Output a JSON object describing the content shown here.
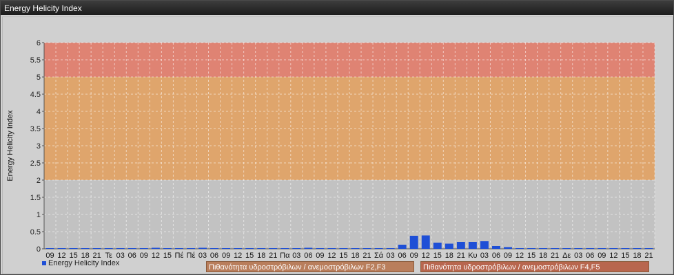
{
  "window": {
    "title": "Energy Helicity Index"
  },
  "colors": {
    "band_low": "#c0c0c0",
    "band_mid": "#e0a060",
    "band_high": "#e07a68",
    "bar": "#1e4fd6"
  },
  "legend": {
    "series_label": "Energy Helicity Index",
    "bands": [
      {
        "label": "Πιθανότητα υδροστρόβιλων / ανεμοστρόβιλων F2,F3",
        "color": "#b97e5c"
      },
      {
        "label": "Πιθανότητα υδροστρόβιλων / ανεμοστρόβιλων F4,F5",
        "color": "#b8664e"
      }
    ]
  },
  "chart_data": {
    "type": "bar",
    "ylabel": "Energy Helicity Index",
    "xlabel": "",
    "ylim": [
      0,
      6
    ],
    "yticks": [
      "6",
      "5.5",
      "5",
      "4.5",
      "4",
      "3.5",
      "3",
      "2.5",
      "2",
      "1.5",
      "1",
      "0.5",
      "0"
    ],
    "bands": [
      {
        "from": 0,
        "to": 2,
        "color": "#c0c0c0"
      },
      {
        "from": 2,
        "to": 5,
        "color": "#e0a060"
      },
      {
        "from": 5,
        "to": 6,
        "color": "#e07a68"
      }
    ],
    "categories": [
      "09",
      "12",
      "15",
      "18",
      "21",
      "Τε",
      "03",
      "06",
      "09",
      "12",
      "15",
      "Πέ",
      "Πέ",
      "03",
      "06",
      "09",
      "12",
      "15",
      "18",
      "21",
      "Πα",
      "03",
      "06",
      "09",
      "12",
      "15",
      "18",
      "21",
      "Σά",
      "03",
      "06",
      "09",
      "12",
      "15",
      "18",
      "21",
      "Κυ",
      "03",
      "06",
      "09",
      "12",
      "15",
      "18",
      "21",
      "Δε",
      "03",
      "06",
      "09",
      "12",
      "15",
      "18",
      "21"
    ],
    "values": [
      0.02,
      0.02,
      0.02,
      0.02,
      0.02,
      0.02,
      0.02,
      0.02,
      0.02,
      0.03,
      0.02,
      0.02,
      0.02,
      0.03,
      0.02,
      0.02,
      0.02,
      0.02,
      0.02,
      0.02,
      0.02,
      0.02,
      0.03,
      0.02,
      0.02,
      0.02,
      0.02,
      0.02,
      0.02,
      0.02,
      0.12,
      0.38,
      0.39,
      0.18,
      0.15,
      0.2,
      0.2,
      0.22,
      0.08,
      0.05,
      0.02,
      0.02,
      0.02,
      0.02,
      0.02,
      0.02,
      0.02,
      0.02,
      0.02,
      0.02,
      0.02,
      0.02
    ]
  }
}
